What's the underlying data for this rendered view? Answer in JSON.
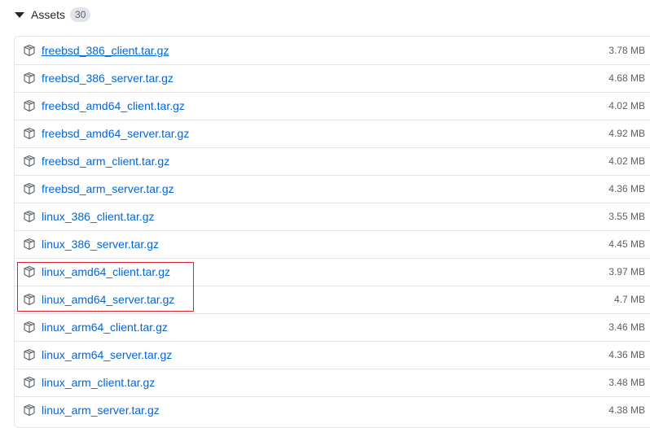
{
  "assets": {
    "title": "Assets",
    "count": "30",
    "highlight_color": "#e0232e",
    "link_color": "#0366d6",
    "items": [
      {
        "name": "freebsd_386_client.tar.gz",
        "size": "3.78 MB"
      },
      {
        "name": "freebsd_386_server.tar.gz",
        "size": "4.68 MB"
      },
      {
        "name": "freebsd_amd64_client.tar.gz",
        "size": "4.02 MB"
      },
      {
        "name": "freebsd_amd64_server.tar.gz",
        "size": "4.92 MB"
      },
      {
        "name": "freebsd_arm_client.tar.gz",
        "size": "4.02 MB"
      },
      {
        "name": "freebsd_arm_server.tar.gz",
        "size": "4.36 MB"
      },
      {
        "name": "linux_386_client.tar.gz",
        "size": "3.55 MB"
      },
      {
        "name": "linux_386_server.tar.gz",
        "size": "4.45 MB"
      },
      {
        "name": "linux_amd64_client.tar.gz",
        "size": "3.97 MB"
      },
      {
        "name": "linux_amd64_server.tar.gz",
        "size": "4.7 MB"
      },
      {
        "name": "linux_arm64_client.tar.gz",
        "size": "3.46 MB"
      },
      {
        "name": "linux_arm64_server.tar.gz",
        "size": "4.36 MB"
      },
      {
        "name": "linux_arm_client.tar.gz",
        "size": "3.48 MB"
      },
      {
        "name": "linux_arm_server.tar.gz",
        "size": "4.38 MB"
      }
    ]
  }
}
